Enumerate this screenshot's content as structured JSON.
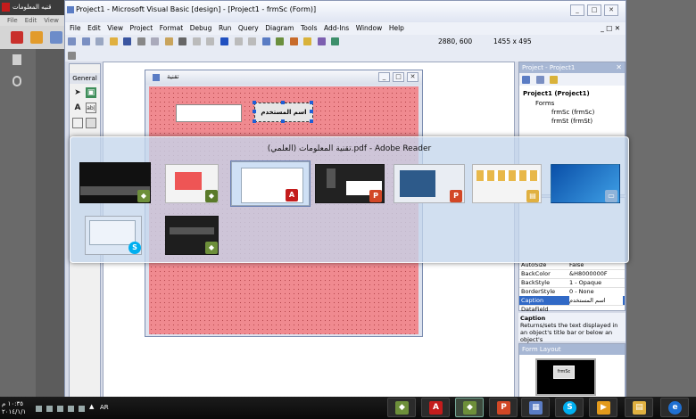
{
  "background_reader": {
    "title": "قنيه المعلومات",
    "menu": [
      "File",
      "Edit",
      "View"
    ]
  },
  "vb_window": {
    "title": "Project1 - Microsoft Visual Basic [design] - [Project1 - frmSc (Form)]",
    "menu": [
      "File",
      "Edit",
      "View",
      "Project",
      "Format",
      "Debug",
      "Run",
      "Query",
      "Diagram",
      "Tools",
      "Add-Ins",
      "Window",
      "Help"
    ],
    "position_readout": "2880, 600",
    "size_readout": "1455 x 495"
  },
  "toolbox": {
    "header": "General",
    "label_tool": "A",
    "textbox_tool": "ab|"
  },
  "form_designer": {
    "title": "تقنية",
    "label_caption": "اسم المستخدم"
  },
  "project_explorer": {
    "header": "Project - Project1",
    "root": "Project1 (Project1)",
    "folder": "Forms",
    "items": [
      "frmSc (frmSc)",
      "frmSt (frmSt)"
    ]
  },
  "properties": {
    "rows": [
      {
        "name": "AutoSize",
        "value": "False"
      },
      {
        "name": "BackColor",
        "value": "&H8000000F"
      },
      {
        "name": "BackStyle",
        "value": "1 - Opaque"
      },
      {
        "name": "BorderStyle",
        "value": "0 - None"
      },
      {
        "name": "Caption",
        "value": "اسم المستخدم"
      },
      {
        "name": "DataField",
        "value": ""
      }
    ]
  },
  "caption_help": {
    "title": "Caption",
    "text": "Returns/sets the text displayed in an object's title bar or below an object's"
  },
  "form_layout": {
    "header": "Form Layout",
    "form_name": "frmSc"
  },
  "alt_tab": {
    "title": "تقنية المعلومات (العلمي).pdf - Adobe Reader"
  },
  "taskbar": {
    "time": "١٠:٣٥ م",
    "date": "٢٠١٤/١/١",
    "language": "AR"
  },
  "colors": {
    "form_grid": "#f08a90",
    "alttab_bg": "#c4d6ec",
    "titlebar": "#dfe5f2"
  }
}
